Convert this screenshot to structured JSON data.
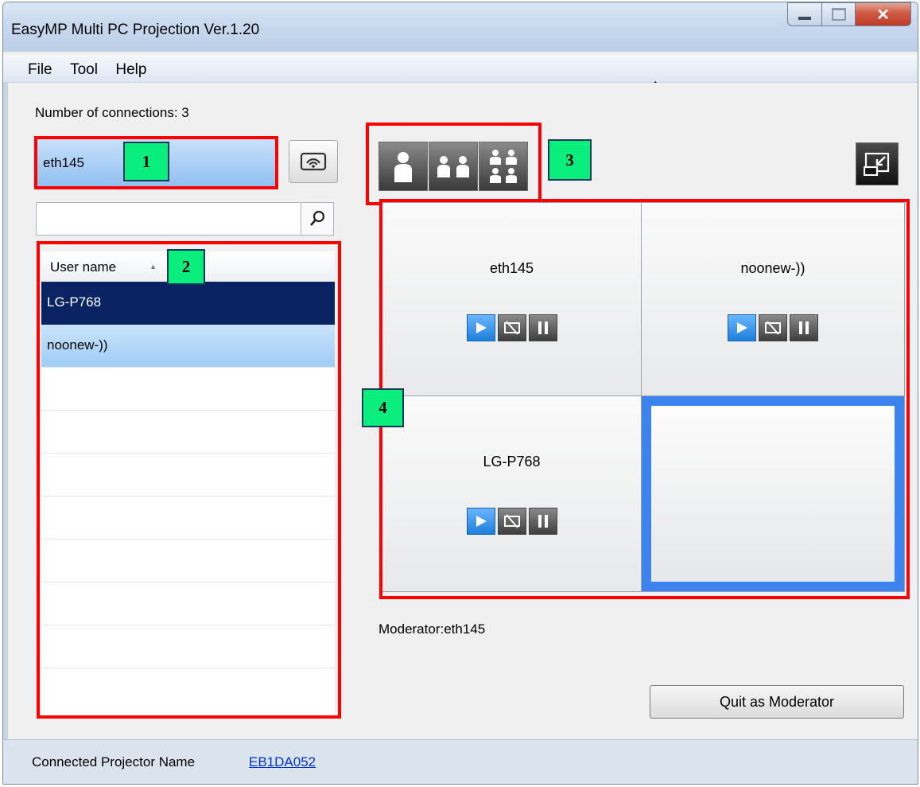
{
  "window": {
    "title": "EasyMP Multi PC Projection Ver.1.20"
  },
  "menu": [
    "File",
    "Tool",
    "Help"
  ],
  "connections_label": "Number of connections: 3",
  "moderator_combo": {
    "value": "eth145"
  },
  "search": {
    "value": ""
  },
  "user_list": {
    "header": "User name",
    "sort_indicator": "▲",
    "rows": [
      "LG-P768",
      "noonew-))",
      "",
      "",
      "",
      "",
      "",
      "",
      ""
    ],
    "selected_row": "LG-P768",
    "highlighted_row": "noonew-))"
  },
  "layout_buttons": [
    "single-user-layout-icon",
    "two-user-layout-icon",
    "four-user-layout-icon"
  ],
  "projection_cells": [
    {
      "name": "eth145",
      "controls": [
        "play-icon",
        "stop-projection-icon",
        "pause-icon"
      ]
    },
    {
      "name": "noonew-))",
      "controls": [
        "play-icon",
        "stop-projection-icon",
        "pause-icon"
      ]
    },
    {
      "name": "LG-P768",
      "controls": [
        "play-icon",
        "stop-projection-icon",
        "pause-icon"
      ]
    },
    {
      "name": "",
      "selected": true
    }
  ],
  "moderator_label": "Moderator:eth145",
  "quit_button": "Quit as Moderator",
  "status": {
    "label": "Connected Projector Name",
    "projector": "EB1DA052"
  },
  "callouts": [
    "1",
    "2",
    "3",
    "4"
  ],
  "colors": {
    "highlight": "#0a2463",
    "selection_blue": "#3c83f0",
    "callout_red": "#ff0000",
    "callout_tag": "#0aee7e"
  }
}
